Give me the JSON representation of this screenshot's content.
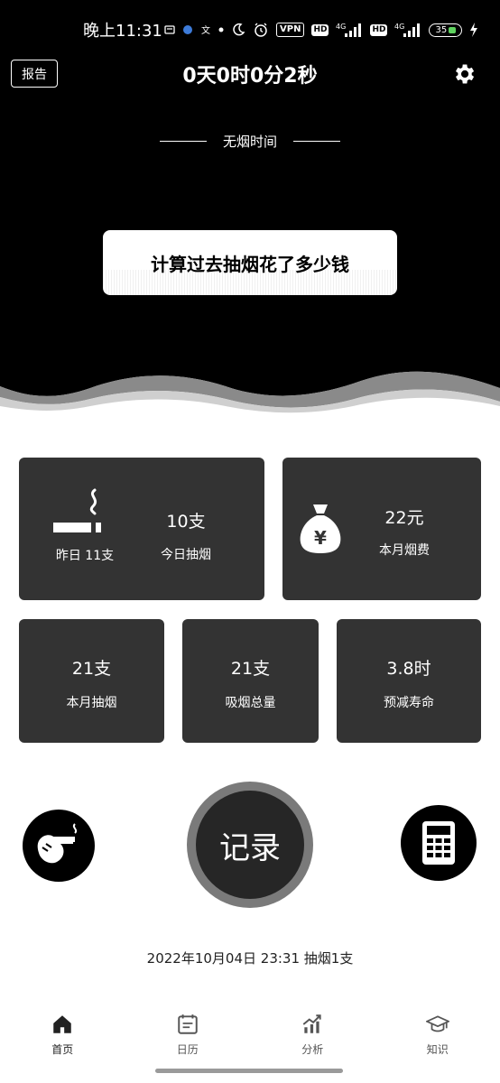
{
  "status_bar": {
    "time": "晚上11:31",
    "vpn": "VPN",
    "hd1": "HD",
    "hd2": "HD",
    "net1": "4G",
    "net2": "4G",
    "battery": "35"
  },
  "header": {
    "report_label": "报告",
    "timer": "0天0时0分2秒",
    "section_title": "无烟时间",
    "calc_cost_label": "计算过去抽烟花了多少钱"
  },
  "cards": {
    "today": {
      "value": "10支",
      "label": "今日抽烟",
      "yesterday": "昨日 11支"
    },
    "month_cost": {
      "value": "22元",
      "label": "本月烟费"
    },
    "month_smoke": {
      "value": "21支",
      "label": "本月抽烟"
    },
    "total": {
      "value": "21支",
      "label": "吸烟总量"
    },
    "life": {
      "value": "3.8时",
      "label": "预减寿命"
    }
  },
  "actions": {
    "record_label": "记录",
    "last_record": "2022年10月04日  23:31   抽烟1支"
  },
  "bottom_nav": {
    "items": [
      {
        "label": "首页",
        "icon": "home-icon"
      },
      {
        "label": "日历",
        "icon": "calendar-icon"
      },
      {
        "label": "分析",
        "icon": "analysis-icon"
      },
      {
        "label": "知识",
        "icon": "knowledge-icon"
      }
    ]
  },
  "colors": {
    "dark": "#000000",
    "card": "#333333",
    "record_ring": "#7a7a7a"
  }
}
